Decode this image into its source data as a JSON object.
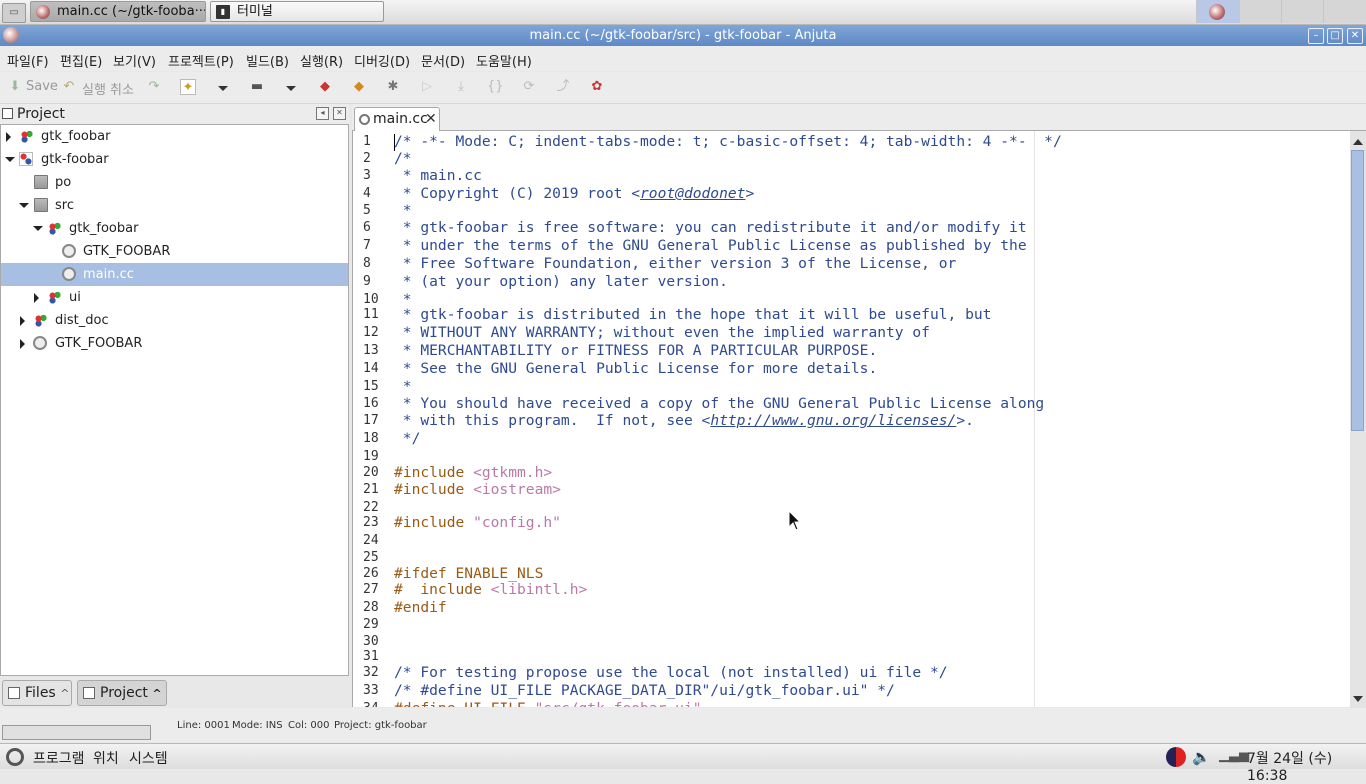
{
  "taskbar": {
    "tasks": [
      {
        "label": "main.cc (~/gtk-fooba···",
        "icon": "anjuta-icon",
        "active": true
      },
      {
        "label": "터미널",
        "icon": "terminal-icon",
        "active": false
      }
    ]
  },
  "window": {
    "title": "main.cc (~/gtk-foobar/src) - gtk-foobar - Anjuta"
  },
  "menubar": {
    "items": [
      "파일(F)",
      "편집(E)",
      "보기(V)",
      "프로젝트(P)",
      "빌드(B)",
      "실행(R)",
      "디버깅(D)",
      "문서(D)",
      "도움말(H)"
    ]
  },
  "toolbar": {
    "save_label": "Save",
    "undo_label": "실행 취소"
  },
  "project_pane": {
    "title": "Project",
    "tree": [
      {
        "label": "gtk_foobar",
        "icon": "target-icon",
        "depth": 0,
        "expander": "closed"
      },
      {
        "label": "gtk-foobar",
        "icon": "project-folder-icon",
        "depth": 0,
        "expander": "open"
      },
      {
        "label": "po",
        "icon": "folder-icon",
        "depth": 1,
        "expander": "none"
      },
      {
        "label": "src",
        "icon": "folder-icon",
        "depth": 1,
        "expander": "open"
      },
      {
        "label": "gtk_foobar",
        "icon": "target-icon",
        "depth": 2,
        "expander": "open"
      },
      {
        "label": "GTK_FOOBAR",
        "icon": "package-icon",
        "depth": 3,
        "expander": "none"
      },
      {
        "label": "main.cc",
        "icon": "source-file-icon",
        "depth": 3,
        "expander": "none",
        "selected": true
      },
      {
        "label": "ui",
        "icon": "target-icon",
        "depth": 2,
        "expander": "closed"
      },
      {
        "label": "dist_doc",
        "icon": "target-icon",
        "depth": 1,
        "expander": "closed"
      },
      {
        "label": "GTK_FOOBAR",
        "icon": "package-icon",
        "depth": 1,
        "expander": "closed"
      }
    ],
    "tabs": [
      {
        "label": "Files",
        "arrow": "^"
      },
      {
        "label": "Project",
        "arrow": "^"
      }
    ]
  },
  "editor": {
    "tab_label": "main.cc",
    "lines": [
      {
        "n": "1",
        "kind": "com",
        "text": "/* -*- Mode: C; indent-tabs-mode: t; c-basic-offset: 4; tab-width: 4 -*-  */"
      },
      {
        "n": "2",
        "kind": "com",
        "text": "/*"
      },
      {
        "n": "3",
        "kind": "com",
        "text": " * main.cc"
      },
      {
        "n": "4",
        "kind": "com",
        "text": " * Copyright (C) 2019 root <",
        "link": "root@dodonet",
        "after": ">"
      },
      {
        "n": "5",
        "kind": "com",
        "text": " *"
      },
      {
        "n": "6",
        "kind": "com",
        "text": " * gtk-foobar is free software: you can redistribute it and/or modify it"
      },
      {
        "n": "7",
        "kind": "com",
        "text": " * under the terms of the GNU General Public License as published by the"
      },
      {
        "n": "8",
        "kind": "com",
        "text": " * Free Software Foundation, either version 3 of the License, or"
      },
      {
        "n": "9",
        "kind": "com",
        "text": " * (at your option) any later version."
      },
      {
        "n": "10",
        "kind": "com",
        "text": " *"
      },
      {
        "n": "11",
        "kind": "com",
        "text": " * gtk-foobar is distributed in the hope that it will be useful, but"
      },
      {
        "n": "12",
        "kind": "com",
        "text": " * WITHOUT ANY WARRANTY; without even the implied warranty of"
      },
      {
        "n": "13",
        "kind": "com",
        "text": " * MERCHANTABILITY or FITNESS FOR A PARTICULAR PURPOSE."
      },
      {
        "n": "14",
        "kind": "com",
        "text": " * See the GNU General Public License for more details."
      },
      {
        "n": "15",
        "kind": "com",
        "text": " *"
      },
      {
        "n": "16",
        "kind": "com",
        "text": " * You should have received a copy of the GNU General Public License along"
      },
      {
        "n": "17",
        "kind": "com",
        "text": " * with this program.  If not, see <",
        "link": "http://www.gnu.org/licenses/",
        "after": ">."
      },
      {
        "n": "18",
        "kind": "com",
        "text": " */"
      },
      {
        "n": "19",
        "kind": "plain",
        "text": ""
      },
      {
        "n": "20",
        "kind": "pp",
        "text": "#include ",
        "str": "<gtkmm.h>"
      },
      {
        "n": "21",
        "kind": "pp",
        "text": "#include ",
        "str": "<iostream>"
      },
      {
        "n": "22",
        "kind": "plain",
        "text": ""
      },
      {
        "n": "23",
        "kind": "pp",
        "text": "#include ",
        "str": "\"config.h\""
      },
      {
        "n": "24",
        "kind": "plain",
        "text": ""
      },
      {
        "n": "25",
        "kind": "plain",
        "text": ""
      },
      {
        "n": "26",
        "kind": "pp",
        "text": "#ifdef ENABLE_NLS"
      },
      {
        "n": "27",
        "kind": "pp",
        "text": "#  include ",
        "str": "<libintl.h>"
      },
      {
        "n": "28",
        "kind": "pp",
        "text": "#endif"
      },
      {
        "n": "29",
        "kind": "plain",
        "text": ""
      },
      {
        "n": "30",
        "kind": "plain",
        "text": ""
      },
      {
        "n": "31",
        "kind": "plain",
        "text": ""
      },
      {
        "n": "32",
        "kind": "com",
        "text": "/* For testing propose use the local (not installed) ui file */"
      },
      {
        "n": "33",
        "kind": "com",
        "text": "/* #define UI_FILE PACKAGE_DATA_DIR\"/ui/gtk_foobar.ui\" */"
      },
      {
        "n": "34",
        "kind": "pp",
        "text": "#define UI_FILE ",
        "str": "\"src/gtk_foobar.ui\""
      }
    ]
  },
  "statusbar": {
    "line": "Line: 0001",
    "mode": "Mode: INS",
    "col": "Col: 000",
    "project": "Project: gtk-foobar"
  },
  "bottom_panel": {
    "menus": [
      "프로그램",
      "위치",
      "시스템"
    ],
    "clock": "7월 24일 (수) 16:38"
  },
  "colors": {
    "titlebar": "#6f97cf",
    "selection": "#a7bfe3",
    "comment": "#2f4a90",
    "preprocessor": "#9a5a16",
    "string": "#b97aa6"
  }
}
